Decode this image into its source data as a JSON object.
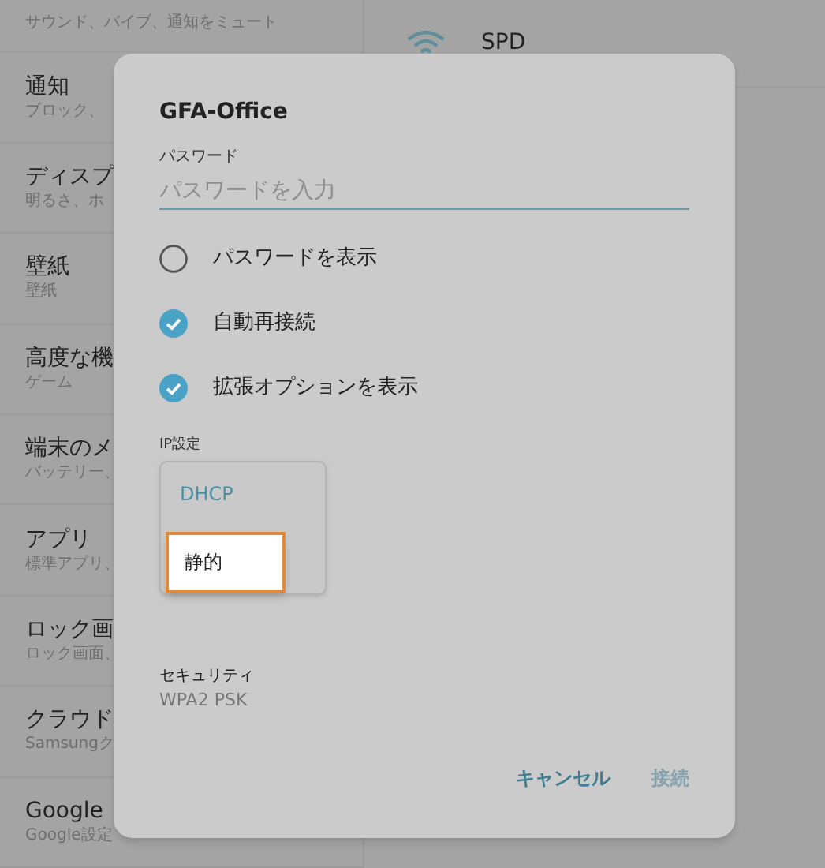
{
  "sidebar": {
    "items": [
      {
        "subtitle": "サウンド、バイブ、通知をミュート"
      },
      {
        "title": "通知",
        "subtitle": "ブロック、"
      },
      {
        "title": "ディスプ",
        "subtitle": "明るさ、ホ"
      },
      {
        "title": "壁紙",
        "subtitle": "壁紙"
      },
      {
        "title": "高度な機",
        "subtitle": "ゲーム"
      },
      {
        "title": "端末のメ",
        "subtitle": "バッテリー、"
      },
      {
        "title": "アプリ",
        "subtitle": "標準アプリ、"
      },
      {
        "title": "ロック画",
        "subtitle": "ロック画面、"
      },
      {
        "title": "クラウド",
        "subtitle": "Samsungク"
      },
      {
        "title": "Google",
        "subtitle": "Google設定"
      }
    ]
  },
  "wifi_list": [
    {
      "name": "SPD"
    }
  ],
  "dialog": {
    "title": "GFA-Office",
    "password": {
      "label": "パスワード",
      "placeholder": "パスワードを入力"
    },
    "options": [
      {
        "label": "パスワードを表示",
        "checked": false
      },
      {
        "label": "自動再接続",
        "checked": true
      },
      {
        "label": "拡張オプションを表示",
        "checked": true
      }
    ],
    "ip_settings": {
      "label": "IP設定",
      "options": [
        {
          "label": "DHCP",
          "selected": true,
          "focused": false
        },
        {
          "label": "静的",
          "selected": false,
          "focused": true
        }
      ]
    },
    "security": {
      "label": "セキュリティ",
      "value": "WPA2 PSK"
    },
    "buttons": [
      {
        "label": "キャンセル",
        "disabled": false
      },
      {
        "label": "接続",
        "disabled": true
      }
    ]
  }
}
